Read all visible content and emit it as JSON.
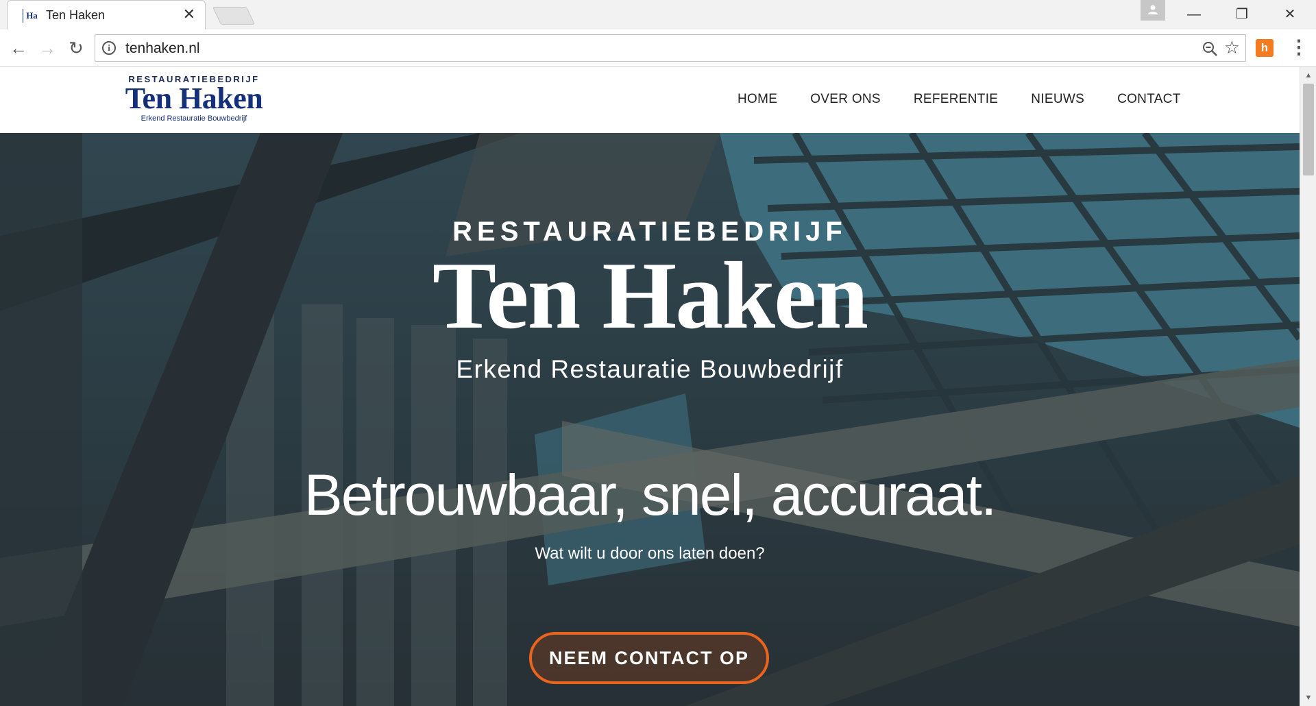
{
  "browser": {
    "tab_title": "Ten Haken",
    "tab_favicon_text": "Ha",
    "close_glyph": "✕",
    "url": "tenhaken.nl",
    "window_controls": {
      "minimize": "—",
      "restore": "❐",
      "close": "✕"
    },
    "nav": {
      "back": "←",
      "forward": "→",
      "reload": "↻"
    },
    "info_glyph": "i",
    "star_glyph": "☆",
    "extension_glyph": "h",
    "menu_glyph": "⋮"
  },
  "site": {
    "logo": {
      "top": "RESTAURATIEBEDRIJF",
      "main": "Ten Haken",
      "sub": "Erkend Restauratie Bouwbedrijf"
    },
    "nav": [
      "HOME",
      "OVER ONS",
      "REFERENTIE",
      "NIEUWS",
      "CONTACT"
    ],
    "hero": {
      "top": "RESTAURATIEBEDRIJF",
      "brand": "Ten Haken",
      "tagline": "Erkend Restauratie Bouwbedrijf",
      "headline": "Betrouwbaar, snel, accuraat.",
      "question": "Wat wilt u door ons laten doen?",
      "cta": "NEEM CONTACT OP"
    }
  },
  "colors": {
    "brand_blue": "#15307a",
    "cta_orange": "#e8651e",
    "sky": "#4d8fa6"
  }
}
